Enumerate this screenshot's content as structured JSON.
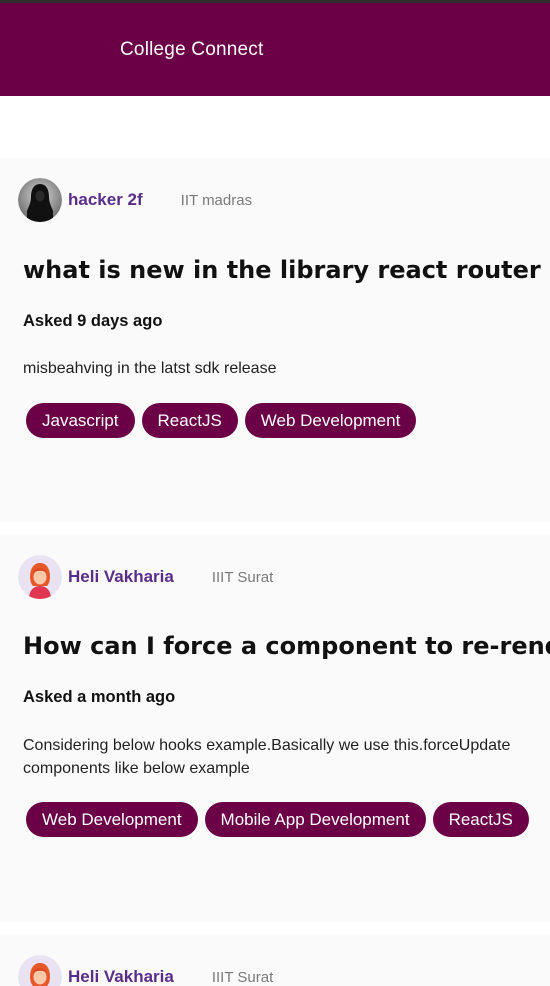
{
  "app": {
    "title": "College Connect"
  },
  "colors": {
    "brand": "#6b0046",
    "username": "#5a2d8a"
  },
  "posts": [
    {
      "avatar_icon": "hooded-figure-avatar-icon",
      "username": "hacker 2f",
      "college": "IIT madras",
      "question": "what is new in the library react router dom",
      "asked": "Asked 9 days ago",
      "description": "misbeahving in the latst sdk release",
      "tags": [
        "Javascript",
        "ReactJS",
        "Web Development"
      ]
    },
    {
      "avatar_icon": "female-avatar-icon",
      "username": "Heli Vakharia",
      "college": "IIIT Surat",
      "question": "How can I force a component to re-render",
      "asked": "Asked a month ago",
      "description": "Considering below hooks example.Basically we use this.forceUpdate\ncomponents like below example",
      "tags": [
        "Web Development",
        "Mobile App Development",
        "ReactJS"
      ]
    },
    {
      "avatar_icon": "female-avatar-icon",
      "username": "Heli Vakharia",
      "college": "IIIT Surat"
    }
  ]
}
